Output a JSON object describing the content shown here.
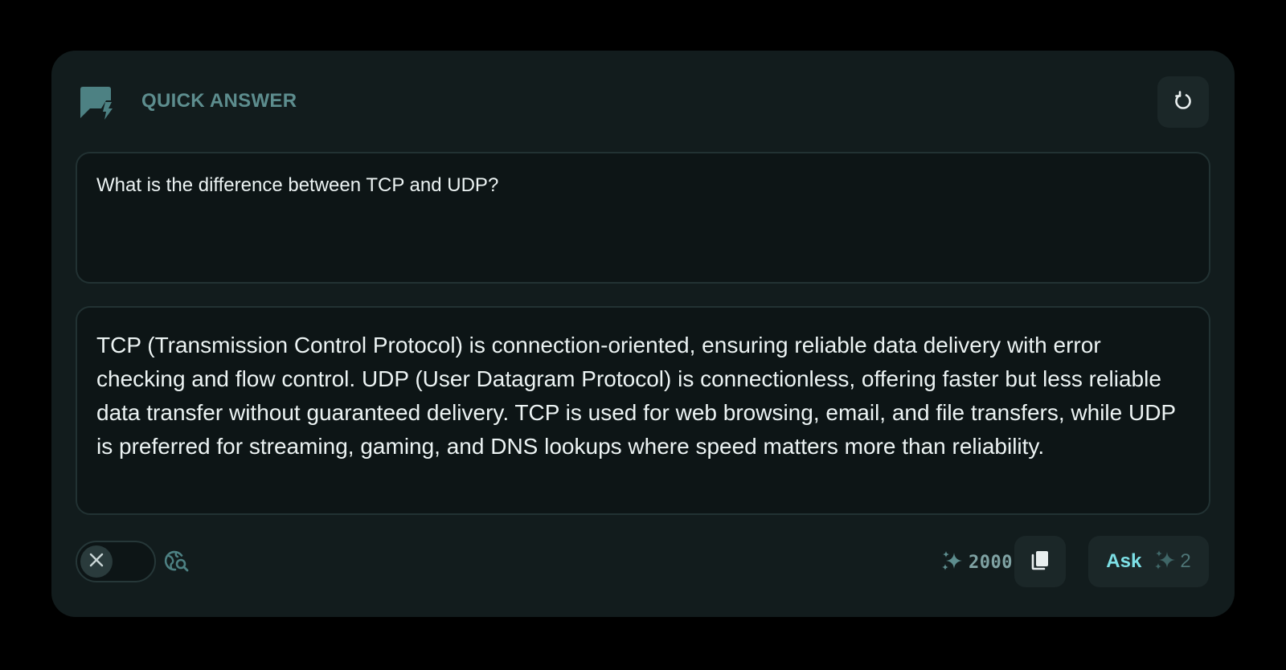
{
  "header": {
    "title": "QUICK ANSWER",
    "icon": "quick-answer-chat-bolt-icon",
    "refresh_icon": "refresh-icon"
  },
  "question": {
    "value": "What is the difference between TCP and UDP?"
  },
  "answer": {
    "text": "TCP (Transmission Control Protocol) is connection-oriented, ensuring reliable data delivery with error checking and flow control. UDP (User Datagram Protocol) is connectionless, offering faster but less reliable data transfer without guaranteed delivery. TCP is used for web browsing, email, and file transfers, while UDP is preferred for streaming, gaming, and DNS lookups where speed matters more than reliability."
  },
  "footer": {
    "toggle_icon": "close-icon",
    "toggle_state": "off",
    "web_search_icon": "globe-search-icon",
    "credits_icon": "sparkles-icon",
    "credits_value": "2000",
    "copy_icon": "copy-icon",
    "ask_label": "Ask",
    "ask_cost_icon": "sparkles-icon",
    "ask_cost": "2"
  },
  "colors": {
    "background": "#000000",
    "card": "#121c1d",
    "box": "#0d1516",
    "border": "#223233",
    "accent": "#7de0e6",
    "muted": "#5d8d8e",
    "text": "#ecf3f3"
  }
}
